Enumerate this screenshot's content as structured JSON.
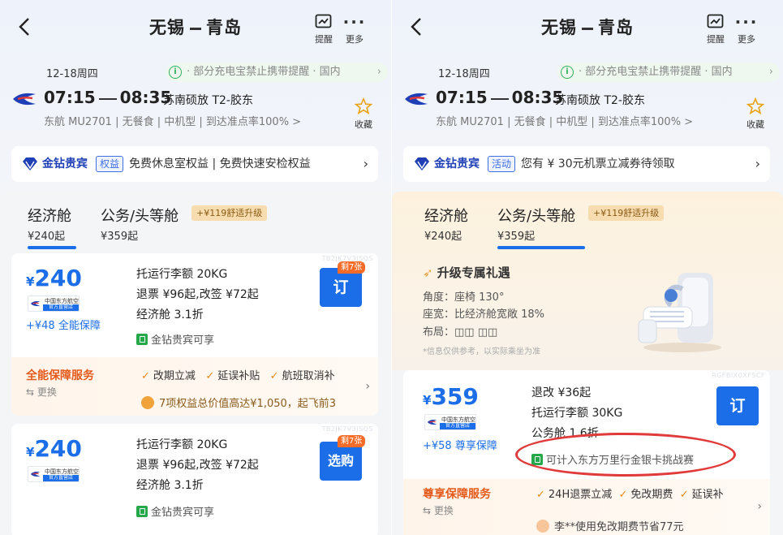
{
  "header": {
    "from": "无锡",
    "to": "青岛",
    "remind_label": "提醒",
    "more_label": "更多"
  },
  "flight": {
    "date": "12-18周四",
    "notice": "· 部分充电宝禁止携带提醒 · 国内",
    "dep_time": "07:15",
    "arr_time": "08:35",
    "airports": "苏南硕放 T2-胶东",
    "details": "东航 MU2701 | 无餐食 | 中机型 | 到达准点率100% >",
    "fav_label": "收藏"
  },
  "left": {
    "vip": {
      "title": "金钻贵宾",
      "tag": "权益",
      "text": "免费休息室权益 | 免费快速安检权益"
    },
    "tabs": [
      {
        "name": "经济舱",
        "price": "¥240起"
      },
      {
        "name": "公务/头等舱",
        "price": "¥359起"
      }
    ],
    "upgrade_badge": "+¥119舒适升级",
    "cards": [
      {
        "code": "TB2JK7V3JSQS",
        "currency": "¥",
        "price": "240",
        "airline_cn": "中国东方航空",
        "airline_sub": "官方直营店",
        "guarantee": "+¥48 全能保障",
        "lines": [
          "托运行李额 20KG",
          "退票 ¥96起,改签 ¥72起",
          "经济舱 3.1折"
        ],
        "vip": "金钻贵宾可享",
        "remaining": "剩7张",
        "book": "订",
        "service": {
          "title": "全能保障服务",
          "swap": "⇆ 更换",
          "items": [
            "改期立减",
            "延误补贴",
            "航班取消补"
          ],
          "note": "7项权益总价值高达¥1,050，起飞前3"
        }
      },
      {
        "code": "TB2JK7V3JSQS",
        "currency": "¥",
        "price": "240",
        "airline_cn": "中国东方航空",
        "airline_sub": "官方直营店",
        "lines": [
          "托运行李额 20KG",
          "退票 ¥96起,改签 ¥72起",
          "经济舱 3.1折"
        ],
        "vip": "金钻贵宾可享",
        "remaining": "剩7张",
        "book": "选购"
      }
    ]
  },
  "right": {
    "vip": {
      "title": "金钻贵宾",
      "tag": "活动",
      "text": "您有 ¥ 30元机票立减券待领取"
    },
    "upgrade": {
      "title": "升级专属礼遇",
      "lines": [
        "角度：座椅 130°",
        "座宽：比经济舱宽敞 18%",
        "布局：◫◫ ◫◫"
      ],
      "note": "*信息仅供参考，以实际乘坐为准"
    },
    "card": {
      "code": "RGFBIX0XFSCF",
      "currency": "¥",
      "price": "359",
      "airline_cn": "中国东方航空",
      "airline_sub": "官方直营店",
      "guarantee": "+¥58 尊享保障",
      "lines": [
        "退改 ¥36起",
        "托运行李额 30KG",
        "公务舱 1.6折"
      ],
      "promo": "可计入东方万里行金银卡挑战赛",
      "book": "订",
      "service": {
        "title": "尊享保障服务",
        "swap": "⇆ 更换",
        "items": [
          "24H退票立减",
          "免改期费",
          "延误补"
        ],
        "note": "李**使用免改期费节省77元"
      }
    }
  },
  "colors": {
    "accent": "#1c6ee8",
    "vip_blue": "#1f3fb6",
    "service_orange": "#e45a1b",
    "highlight_red": "#e03a3a"
  }
}
